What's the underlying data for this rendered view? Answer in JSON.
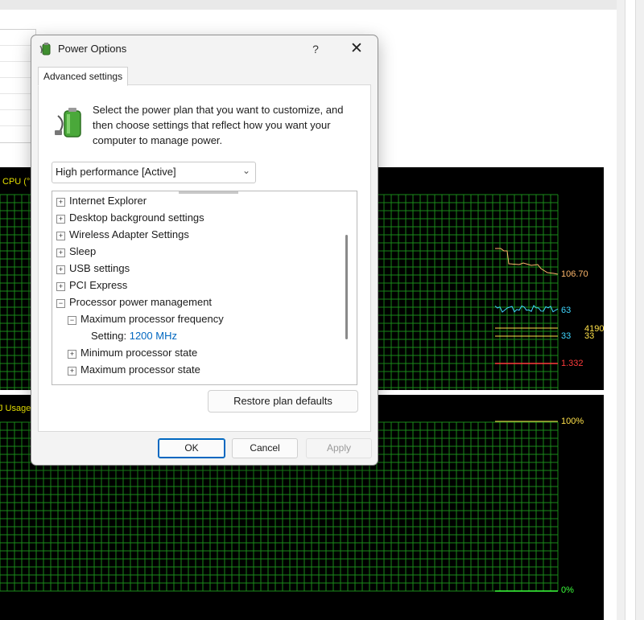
{
  "background": {
    "cpu_graph_label": "CPU (°",
    "gpu_graph_label": "J Usage",
    "cpu_readings": [
      {
        "text": "106.70",
        "color": "#ffb86c"
      },
      {
        "text": "63",
        "color": "#3fd7ff"
      },
      {
        "text": "4190",
        "color": "#ffe14a"
      },
      {
        "text": "33",
        "color": "#3fd7ff"
      },
      {
        "text": "33",
        "color": "#ffe14a"
      },
      {
        "text": "1.332",
        "color": "#ff3b3b"
      }
    ],
    "gpu_readings": {
      "top": "100%",
      "bottom": "0%"
    },
    "grid_color": "#1a8a1a",
    "label_color": "#e6e000"
  },
  "dialog": {
    "title": "Power Options",
    "help_label": "?",
    "close_label": "✕",
    "tab_label": "Advanced settings",
    "intro_text": "Select the power plan that you want to customize, and then choose settings that reflect how you want your computer to manage power.",
    "plan_select": {
      "value": "High performance [Active]"
    },
    "tree": [
      {
        "label": "Internet Explorer",
        "expander": "+"
      },
      {
        "label": "Desktop background settings",
        "expander": "+"
      },
      {
        "label": "Wireless Adapter Settings",
        "expander": "+"
      },
      {
        "label": "Sleep",
        "expander": "+"
      },
      {
        "label": "USB settings",
        "expander": "+"
      },
      {
        "label": "PCI Express",
        "expander": "+"
      },
      {
        "label": "Processor power management",
        "expander": "−"
      },
      {
        "label": "Maximum processor frequency",
        "expander": "−"
      },
      {
        "label": "Setting:",
        "value": "1200 MHz"
      },
      {
        "label": "Minimum processor state",
        "expander": "+"
      },
      {
        "label": "Maximum processor state",
        "expander": "+"
      }
    ],
    "restore_label": "Restore plan defaults",
    "ok_label": "OK",
    "cancel_label": "Cancel",
    "apply_label": "Apply",
    "accent_color": "#0067c0"
  }
}
